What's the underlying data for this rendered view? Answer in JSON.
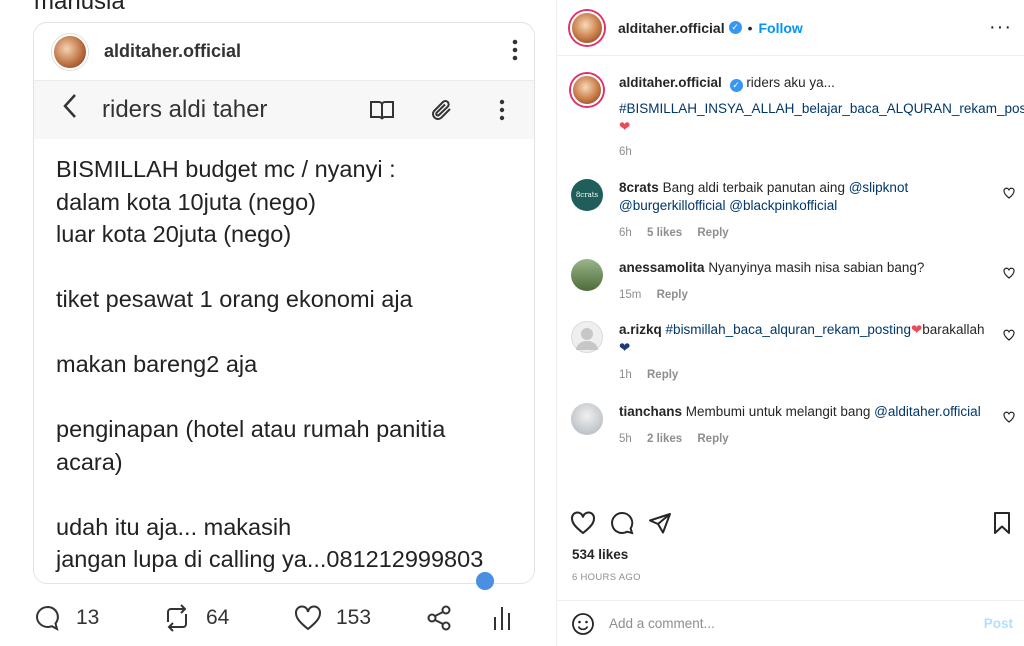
{
  "left": {
    "cut_text": "manusia",
    "card": {
      "username": "alditaher.official",
      "note_title": "riders aldi taher",
      "note_lines": [
        "BISMILLAH budget mc / nyanyi :",
        "dalam kota 10juta (nego)",
        "luar kota 20juta (nego)",
        "",
        "tiket  pesawat 1 orang ekonomi aja",
        "",
        "makan bareng2 aja",
        "",
        "penginapan (hotel atau rumah panitia",
        "acara)",
        "",
        "udah itu aja... makasih",
        "jangan lupa di calling ya...081212999803"
      ]
    },
    "stats": {
      "replies": "13",
      "reposts": "64",
      "likes": "153"
    }
  },
  "right": {
    "header": {
      "username": "alditaher.official",
      "separator": "•",
      "follow": "Follow",
      "more": "···"
    },
    "caption": {
      "username": "alditaher.official",
      "text": "riders aku ya...",
      "hashtag": "#BISMILLAH_INSYA_ALLAH_belajar_baca_ALQURAN_rekam_posting",
      "time": "6h"
    },
    "comments": [
      {
        "username": "8crats",
        "text": "Bang aldi terbaik panutan aing",
        "mentions": "@slipknot @burgerkillofficial @blackpinkofficial",
        "mention1": "@slipknot",
        "mention2": "@burgerkillofficial",
        "mention3": "@blackpinkofficial",
        "time": "6h",
        "likes": "5 likes",
        "reply": "Reply"
      },
      {
        "username": "anessamolita",
        "text": "Nyanyinya masih nisa sabian bang?",
        "time": "15m",
        "reply": "Reply"
      },
      {
        "username": "a.rizkq",
        "hashtag": "#bismillah_baca_alquran_rekam_posting",
        "text_after": "barakallah",
        "time": "1h",
        "reply": "Reply"
      },
      {
        "username": "tianchans",
        "text": "Membumi untuk melangit bang",
        "mention": "@alditaher.official",
        "time": "5h",
        "likes": "2 likes",
        "reply": "Reply"
      }
    ],
    "likes": "534 likes",
    "time": "6 HOURS AGO",
    "add_comment": {
      "placeholder": "Add a comment...",
      "post": "Post"
    }
  }
}
